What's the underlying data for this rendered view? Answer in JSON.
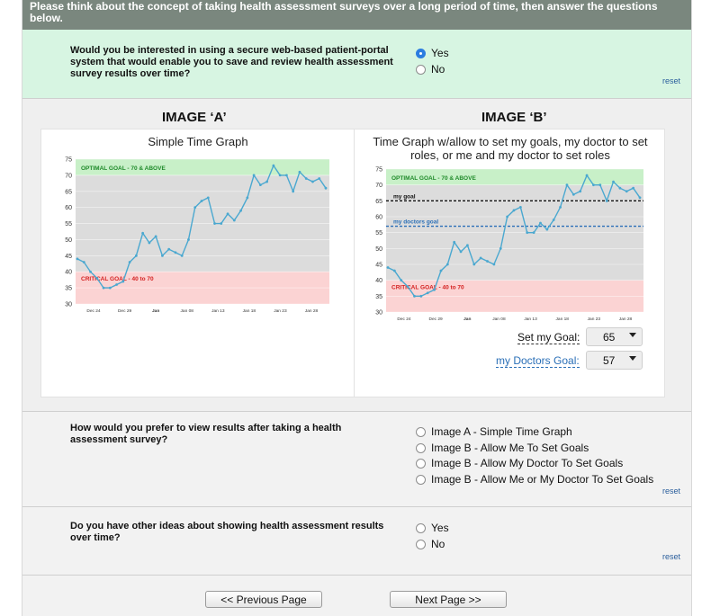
{
  "header": {
    "text": "Please think about the concept of taking health assessment surveys over a long period of time, then answer the questions below."
  },
  "q1": {
    "text": "Would you be interested in using a secure web-based patient-portal system that would enable you to save and review health assessment survey results over time?",
    "options": [
      "Yes",
      "No"
    ],
    "selected": "Yes",
    "reset": "reset"
  },
  "images": {
    "a_title": "IMAGE ‘A’",
    "b_title": "IMAGE ‘B’",
    "a_caption": "Simple Time Graph",
    "b_caption": "Time Graph w/allow to set my goals, my doctor to set roles, or me and my doctor to set roles",
    "optimal_label": "OPTIMAL GOAL - 70 & ABOVE",
    "critical_label": "CRITICAL GOAL - 40 to 70",
    "my_goal_label": "my goal",
    "doctors_goal_label": "my doctors goal",
    "set_my_goal_label": "Set my Goal:",
    "set_my_goal_value": "65",
    "doctors_goal_select_label": "my Doctors Goal:",
    "doctors_goal_value": "57"
  },
  "chart_data": [
    {
      "type": "line",
      "title": "Simple Time Graph",
      "ylim": [
        30,
        75
      ],
      "yticks": [
        "75",
        "70",
        "65",
        "60",
        "55",
        "50",
        "45",
        "40",
        "35",
        "30"
      ],
      "xticks": [
        "Dec 24",
        "Dec 29",
        "Jan",
        "Jan 08",
        "Jan 13",
        "Jan 18",
        "Jan 23",
        "Jan 28"
      ],
      "bands": [
        {
          "label": "OPTIMAL GOAL - 70 & ABOVE",
          "from": 70,
          "to": 75,
          "color": "#c8f0c8"
        },
        {
          "label": "",
          "from": 40,
          "to": 70,
          "color": "#dcdcdc"
        },
        {
          "label": "CRITICAL GOAL - 40 to 70",
          "from": 30,
          "to": 40,
          "color": "#fbd3d3"
        }
      ],
      "values": [
        44,
        43,
        40,
        38,
        35,
        35,
        36,
        37,
        43,
        45,
        52,
        49,
        51,
        45,
        47,
        46,
        45,
        50,
        60,
        62,
        63,
        55,
        55,
        58,
        56,
        59,
        63,
        70,
        67,
        68,
        73,
        70,
        70,
        65,
        71,
        69,
        68,
        69,
        66
      ]
    },
    {
      "type": "line",
      "title": "Time Graph w/allow to set my goals, my doctor to set roles, or me and my doctor to set roles",
      "ylim": [
        30,
        75
      ],
      "yticks": [
        "75",
        "70",
        "65",
        "60",
        "55",
        "50",
        "45",
        "40",
        "35",
        "30"
      ],
      "xticks": [
        "Dec 24",
        "Dec 29",
        "Jan",
        "Jan 08",
        "Jan 13",
        "Jan 18",
        "Jan 23",
        "Jan 28"
      ],
      "bands": [
        {
          "label": "OPTIMAL GOAL - 70 & ABOVE",
          "from": 70,
          "to": 75,
          "color": "#c8f0c8"
        },
        {
          "label": "",
          "from": 40,
          "to": 70,
          "color": "#dcdcdc"
        },
        {
          "label": "CRITICAL GOAL - 40 to 70",
          "from": 30,
          "to": 40,
          "color": "#fbd3d3"
        }
      ],
      "goal_lines": [
        {
          "label": "my goal",
          "value": 65,
          "color": "#111111"
        },
        {
          "label": "my doctors goal",
          "value": 57,
          "color": "#2a6fb7"
        }
      ],
      "values": [
        44,
        43,
        40,
        38,
        35,
        35,
        36,
        37,
        43,
        45,
        52,
        49,
        51,
        45,
        47,
        46,
        45,
        50,
        60,
        62,
        63,
        55,
        55,
        58,
        56,
        59,
        63,
        70,
        67,
        68,
        73,
        70,
        70,
        65,
        71,
        69,
        68,
        69,
        66
      ]
    }
  ],
  "q2": {
    "text": "How would you prefer to view results after taking a health assessment survey?",
    "options": [
      "Image A - Simple Time Graph",
      "Image B - Allow Me To Set Goals",
      "Image B - Allow My Doctor To Set Goals",
      "Image B - Allow Me or My Doctor To Set Goals"
    ],
    "reset": "reset"
  },
  "q3": {
    "text": "Do you have other ideas about showing health assessment results over time?",
    "options": [
      "Yes",
      "No"
    ],
    "reset": "reset"
  },
  "nav": {
    "prev": "<< Previous Page",
    "next": "Next Page >>"
  },
  "colors": {
    "line": "#4aa8d0",
    "optimal": "#c8f0c8",
    "critical": "#fbd3d3",
    "mid": "#dcdcdc",
    "selected_radio": "#2c7de0"
  }
}
